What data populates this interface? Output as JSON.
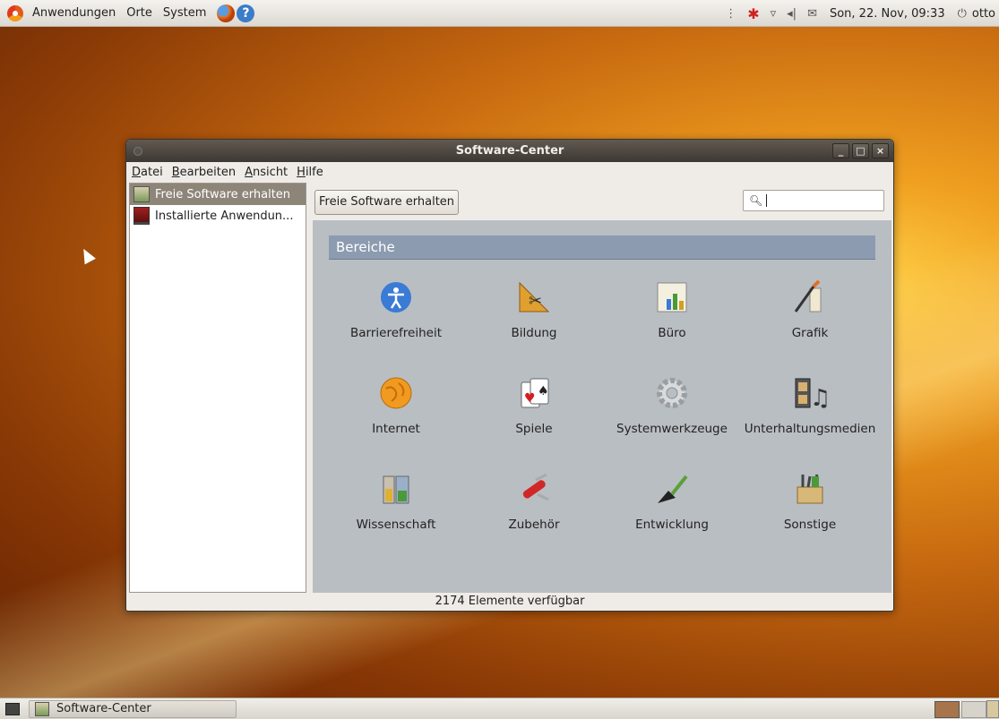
{
  "top_panel": {
    "menus": [
      "Anwendungen",
      "Orte",
      "System"
    ],
    "clock": "Son, 22. Nov, 09:33",
    "user": "otto"
  },
  "window": {
    "title": "Software-Center",
    "menubar": [
      {
        "underline": "D",
        "rest": "atei"
      },
      {
        "underline": "B",
        "rest": "earbeiten"
      },
      {
        "underline": "A",
        "rest": "nsicht"
      },
      {
        "underline": "H",
        "rest": "ilfe"
      }
    ],
    "sidebar": [
      "Freie Software erhalten",
      "Installierte Anwendun..."
    ],
    "breadcrumb": "Freie Software erhalten",
    "search_value": "",
    "section_title": "Bereiche",
    "categories": [
      {
        "label": "Barrierefreiheit",
        "icon": "accessibility-icon"
      },
      {
        "label": "Bildung",
        "icon": "education-icon"
      },
      {
        "label": "Büro",
        "icon": "office-icon"
      },
      {
        "label": "Grafik",
        "icon": "graphics-icon"
      },
      {
        "label": "Internet",
        "icon": "internet-icon"
      },
      {
        "label": "Spiele",
        "icon": "games-icon"
      },
      {
        "label": "Systemwerkzeuge",
        "icon": "system-tools-icon"
      },
      {
        "label": "Unterhaltungsmedien",
        "icon": "multimedia-icon"
      },
      {
        "label": "Wissenschaft",
        "icon": "science-icon"
      },
      {
        "label": "Zubehör",
        "icon": "accessories-icon"
      },
      {
        "label": "Entwicklung",
        "icon": "development-icon"
      },
      {
        "label": "Sonstige",
        "icon": "other-icon"
      }
    ],
    "status": "2174 Elemente verfügbar"
  },
  "bottom_panel": {
    "task": "Software-Center"
  }
}
